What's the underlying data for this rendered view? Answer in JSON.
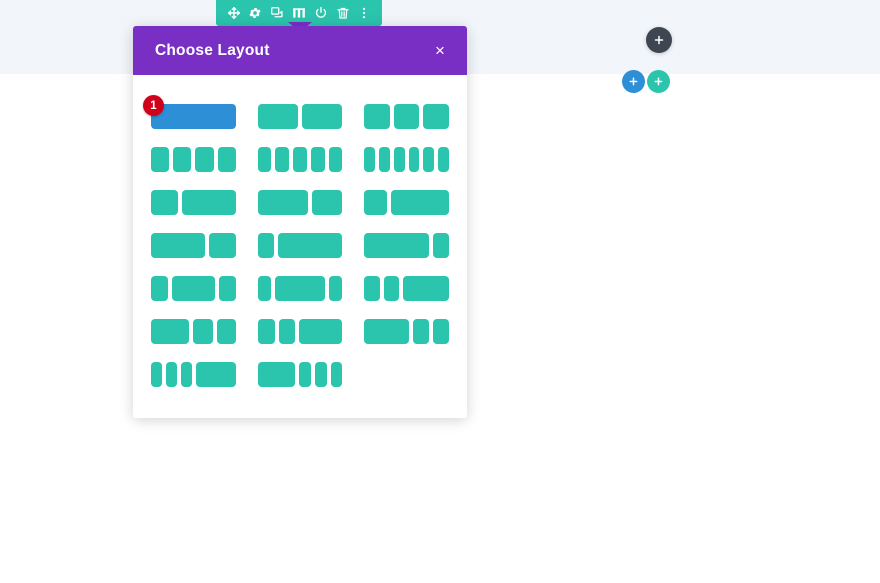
{
  "page": {
    "background_top_band_color": "#f2f6fa",
    "background_color": "#ffffff"
  },
  "module_toolbar": {
    "background_color": "#2bc4ad",
    "icons": [
      {
        "name": "move-icon",
        "label": "Move",
        "glyph": "move"
      },
      {
        "name": "gear-icon",
        "label": "Settings",
        "glyph": "gear"
      },
      {
        "name": "duplicate-icon",
        "label": "Duplicate",
        "glyph": "duplicate"
      },
      {
        "name": "columns-layout-icon",
        "label": "Choose Layout",
        "glyph": "columns",
        "active": true
      },
      {
        "name": "power-icon",
        "label": "Disable",
        "glyph": "power"
      },
      {
        "name": "trash-icon",
        "label": "Delete",
        "glyph": "trash"
      },
      {
        "name": "more-options-icon",
        "label": "More Options",
        "glyph": "dots"
      }
    ]
  },
  "modal": {
    "title": "Choose Layout",
    "close_label": "×",
    "header_color": "#7a2fc4",
    "selected_color": "#2d8fd5",
    "option_color": "#2bc4ad",
    "badge_color": "#d0021b",
    "selected_badge": "1",
    "layouts": [
      {
        "id": "1-col",
        "selected": true,
        "widths": [
          100
        ]
      },
      {
        "id": "2-col",
        "selected": false,
        "widths": [
          50,
          50
        ]
      },
      {
        "id": "3-col",
        "selected": false,
        "widths": [
          33.33,
          33.33,
          33.33
        ]
      },
      {
        "id": "4-col",
        "selected": false,
        "widths": [
          25,
          25,
          25,
          25
        ]
      },
      {
        "id": "5-col",
        "selected": false,
        "widths": [
          20,
          20,
          20,
          20,
          20
        ]
      },
      {
        "id": "6-col",
        "selected": false,
        "widths": [
          16.6,
          16.6,
          16.6,
          16.6,
          16.6,
          16.6
        ]
      },
      {
        "id": "1-3__2-3",
        "selected": false,
        "widths": [
          33.33,
          66.66
        ]
      },
      {
        "id": "3-5__2-5",
        "selected": false,
        "widths": [
          62,
          38
        ]
      },
      {
        "id": "1-4__3-4",
        "selected": false,
        "widths": [
          28,
          72
        ]
      },
      {
        "id": "2-3__1-3",
        "selected": false,
        "widths": [
          66.66,
          33.33
        ]
      },
      {
        "id": "1-5__4-5",
        "selected": false,
        "widths": [
          20,
          80
        ]
      },
      {
        "id": "4-5__1-5",
        "selected": false,
        "widths": [
          80,
          20
        ]
      },
      {
        "id": "1-4__1-2__1-4",
        "selected": false,
        "widths": [
          22,
          56,
          22
        ]
      },
      {
        "id": "1-5__3-5__1-5",
        "selected": false,
        "widths": [
          18,
          64,
          18
        ]
      },
      {
        "id": "1-5__1-5__3-5",
        "selected": false,
        "widths": [
          20,
          20,
          60
        ]
      },
      {
        "id": "1-2__1-4__1-4",
        "selected": false,
        "widths": [
          50,
          25,
          25
        ]
      },
      {
        "id": "1-4__1-4__1-2",
        "selected": false,
        "widths": [
          22,
          22,
          56
        ]
      },
      {
        "id": "1-2__1-4__1-4-b",
        "selected": false,
        "widths": [
          58,
          21,
          21
        ]
      },
      {
        "id": "3x1-6__1-2",
        "selected": false,
        "widths": [
          15,
          15,
          15,
          55
        ]
      },
      {
        "id": "1-2__3x1-6",
        "selected": false,
        "widths": [
          52,
          16,
          16,
          16
        ]
      },
      {
        "id": "empty",
        "selected": false,
        "widths": []
      }
    ]
  },
  "floating_buttons": [
    {
      "name": "add-section-button",
      "label": "+",
      "color": "#3e4652"
    },
    {
      "name": "add-row-button",
      "label": "+",
      "color": "#2d8fd5"
    },
    {
      "name": "add-module-button",
      "label": "+",
      "color": "#2bc4ad"
    }
  ]
}
